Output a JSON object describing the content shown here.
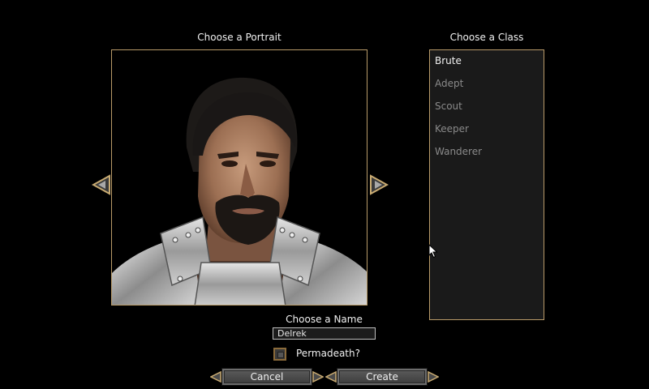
{
  "portrait": {
    "heading": "Choose a Portrait"
  },
  "class_panel": {
    "heading": "Choose a Class",
    "items": [
      {
        "label": "Brute",
        "selected": true
      },
      {
        "label": "Adept",
        "selected": false
      },
      {
        "label": "Scout",
        "selected": false
      },
      {
        "label": "Keeper",
        "selected": false
      },
      {
        "label": "Wanderer",
        "selected": false
      }
    ]
  },
  "name": {
    "heading": "Choose a Name",
    "value": "Delrek"
  },
  "permadeath": {
    "label": "Permadeath?",
    "checked": false
  },
  "buttons": {
    "cancel": "Cancel",
    "create": "Create"
  },
  "icons": {
    "prev": "left-arrow-icon",
    "next": "right-arrow-icon",
    "cursor": "mouse-pointer-icon"
  },
  "colors": {
    "frame": "#b89a68",
    "panel": "#1a1a1a",
    "background": "#000000"
  }
}
